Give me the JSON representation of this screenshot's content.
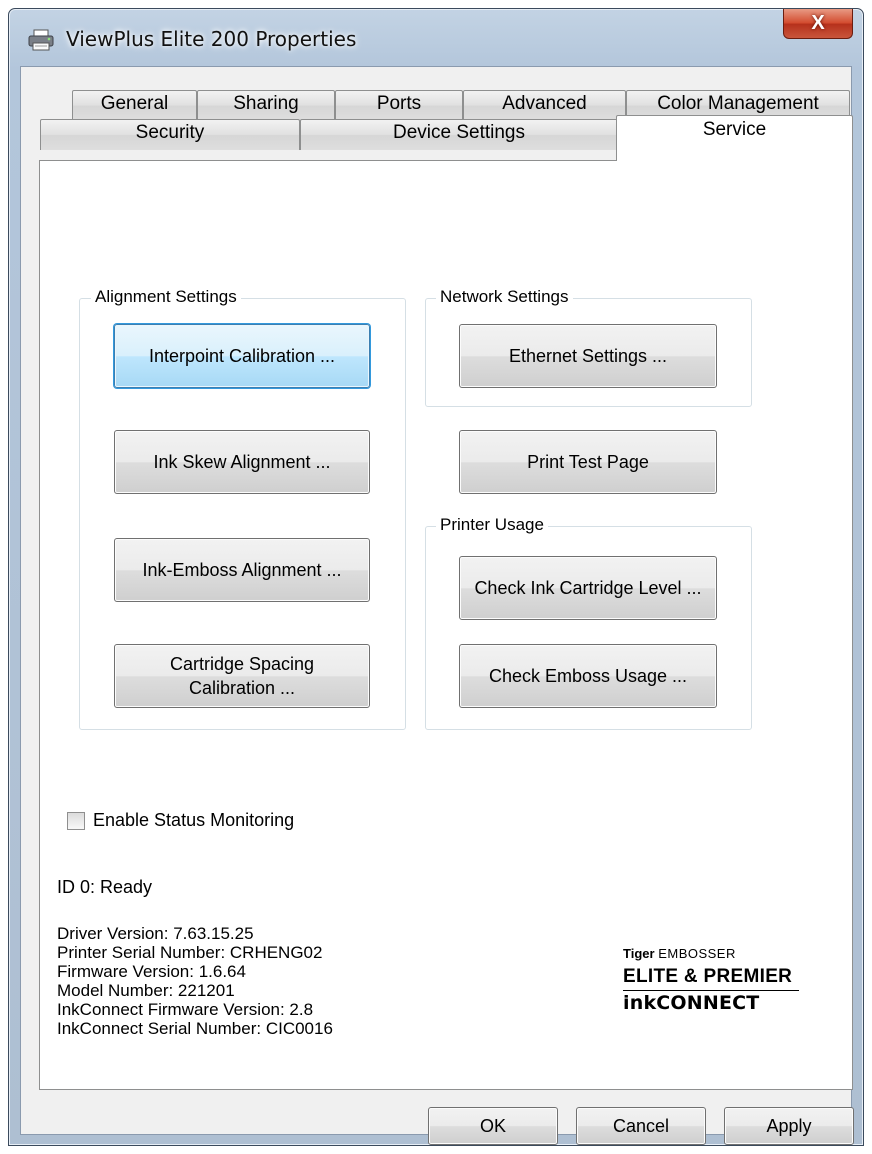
{
  "window": {
    "title": "ViewPlus Elite 200 Properties",
    "close_glyph": "X"
  },
  "tabs": {
    "row_back": [
      "General",
      "Sharing",
      "Ports",
      "Advanced",
      "Color Management"
    ],
    "row_front": [
      "Security",
      "Device Settings",
      "Service"
    ],
    "active": "Service"
  },
  "alignment": {
    "title": "Alignment Settings",
    "buttons": [
      "Interpoint Calibration ...",
      "Ink Skew Alignment ...",
      "Ink-Emboss Alignment ...",
      "Cartridge Spacing\nCalibration ..."
    ]
  },
  "network": {
    "title": "Network Settings",
    "ethernet_button": "Ethernet Settings ..."
  },
  "print_test_button": "Print Test Page",
  "printer_usage": {
    "title": "Printer Usage",
    "buttons": [
      "Check Ink Cartridge Level ...",
      "Check Emboss Usage ..."
    ]
  },
  "status_monitoring": {
    "label": "Enable Status Monitoring",
    "checked": false
  },
  "status_text": "ID 0: Ready",
  "info": [
    "Driver Version: 7.63.15.25",
    "Printer Serial Number: CRHENG02",
    "Firmware Version: 1.6.64",
    "Model Number: 221201",
    "InkConnect Firmware Version: 2.8",
    "InkConnect Serial Number: CIC0016"
  ],
  "logo": {
    "line1_bold": "Tiger",
    "line1_rest": "EMBOSSER",
    "line2": "ELITE & PREMIER",
    "line3": "inkCONNECT"
  },
  "footer": {
    "ok": "OK",
    "cancel": "Cancel",
    "apply": "Apply"
  },
  "colors": {
    "focus_border": "#3c7fb1",
    "close_red": "#c9553b",
    "window_frame": "#b3c6db"
  },
  "icons": {
    "title": "printer-icon",
    "close": "close-icon",
    "checkbox": "checkbox-icon"
  }
}
